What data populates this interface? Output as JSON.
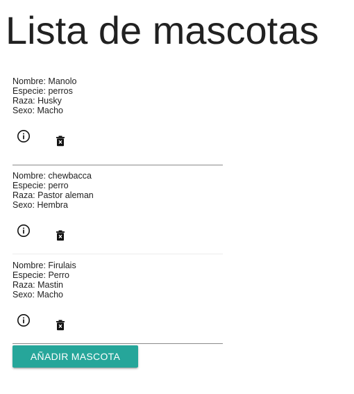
{
  "page": {
    "title": "Lista de mascotas"
  },
  "labels": {
    "name": "Nombre:",
    "species": "Especie:",
    "breed": "Raza:",
    "sex": "Sexo:"
  },
  "pets": [
    {
      "name": "Manolo",
      "species": "perros",
      "breed": "Husky",
      "sex": "Macho",
      "info_icon": "info-circle-icon",
      "delete_icon": "trash-icon"
    },
    {
      "name": "chewbacca",
      "species": "perro",
      "breed": "Pastor aleman",
      "sex": "Hembra",
      "info_icon": "info-circle-icon",
      "delete_icon": "trash-icon"
    },
    {
      "name": "Firulais",
      "species": "Perro",
      "breed": "Mastin",
      "sex": "Macho",
      "info_icon": "info-circle-icon",
      "delete_icon": "trash-icon"
    }
  ],
  "actions": {
    "add_label": "AÑADIR MASCOTA"
  },
  "colors": {
    "accent": "#26a69a",
    "text": "#212121",
    "divider": "#8a8a8a"
  }
}
